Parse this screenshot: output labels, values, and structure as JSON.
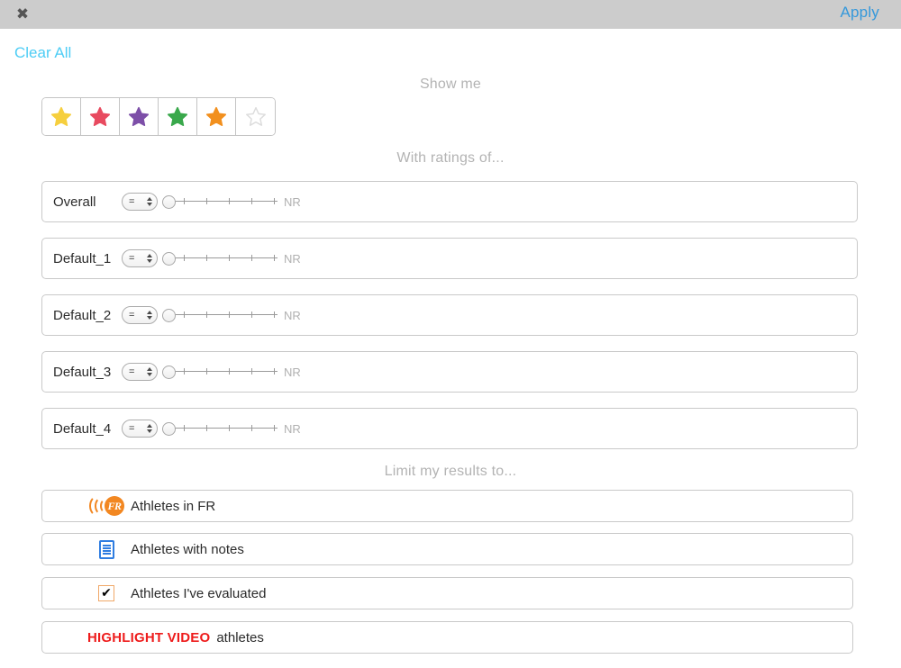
{
  "topbar": {
    "close_label": "✖",
    "close_icon": "close-icon",
    "apply_label": "Apply",
    "background": "#cccccc",
    "apply_color": "#3498db"
  },
  "clear_all": {
    "label": "Clear All",
    "color": "#4ecdf5"
  },
  "sections": {
    "show_me": "Show me",
    "with_ratings": "With ratings of...",
    "limit_results": "Limit my results to..."
  },
  "stars": [
    {
      "name": "star-yellow",
      "color": "#f6cf3e",
      "filled": true,
      "icon": "star-icon"
    },
    {
      "name": "star-red",
      "color": "#e84a5f",
      "filled": true,
      "icon": "star-icon"
    },
    {
      "name": "star-purple",
      "color": "#7d4fa8",
      "filled": true,
      "icon": "star-icon"
    },
    {
      "name": "star-green",
      "color": "#39a84b",
      "filled": true,
      "icon": "star-icon"
    },
    {
      "name": "star-orange",
      "color": "#f2901e",
      "filled": true,
      "icon": "star-icon"
    },
    {
      "name": "star-empty",
      "color": "#dcdcdc",
      "filled": false,
      "icon": "star-outline-icon"
    }
  ],
  "rating_rows": [
    {
      "label": "Overall",
      "operator": "=",
      "slider_value": 0,
      "slider_max_label": "NR",
      "ticks": 5
    },
    {
      "label": "Default_1",
      "operator": "=",
      "slider_value": 0,
      "slider_max_label": "NR",
      "ticks": 5
    },
    {
      "label": "Default_2",
      "operator": "=",
      "slider_value": 0,
      "slider_max_label": "NR",
      "ticks": 5
    },
    {
      "label": "Default_3",
      "operator": "=",
      "slider_value": 0,
      "slider_max_label": "NR",
      "ticks": 5
    },
    {
      "label": "Default_4",
      "operator": "=",
      "slider_value": 0,
      "slider_max_label": "NR",
      "ticks": 5
    }
  ],
  "limit_rows": [
    {
      "icon": "fr-logo-icon",
      "label": "Athletes in FR",
      "accent": "#f28721"
    },
    {
      "icon": "notes-icon",
      "label": "Athletes with notes",
      "accent": "#2f7de1"
    },
    {
      "icon": "checkbox-checked-icon",
      "label": "Athletes I've evaluated",
      "accent": "#f0a868",
      "checked": true
    },
    {
      "icon": "highlight-video-tag",
      "tag": "HIGHLIGHT VIDEO",
      "label": "athletes",
      "accent": "#ee1c1c"
    }
  ]
}
